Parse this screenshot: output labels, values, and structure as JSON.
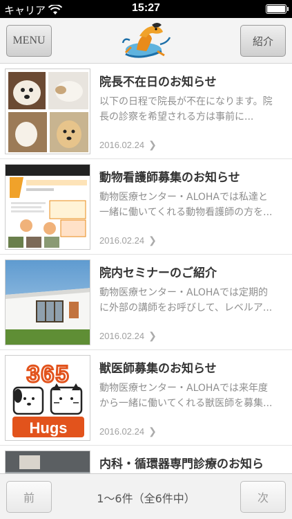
{
  "status_bar": {
    "carrier": "キャリア",
    "time": "15:27"
  },
  "header": {
    "menu_label": "MENU",
    "intro_label": "紹介",
    "logo_icon": "surfing-dog-logo"
  },
  "articles": [
    {
      "title": "院長不在日のお知らせ",
      "excerpt": "以下の日程で院長が不在になります。院長の診察を希望される方は事前に...",
      "date": "2016.02.24"
    },
    {
      "title": "動物看護師募集のお知らせ",
      "excerpt": "動物医療センター・ALOHAでは私達と一緒に働いてくれる動物看護師の方を...",
      "date": "2016.02.24"
    },
    {
      "title": "院内セミナーのご紹介",
      "excerpt": "動物医療センター・ALOHAでは定期的に外部の講師をお呼びして、レベルア...",
      "date": "2016.02.24"
    },
    {
      "title": "獣医師募集のお知らせ",
      "excerpt": "動物医療センター・ALOHAでは来年度から一緒に働いてくれる獣医師を募集...",
      "date": "2016.02.24"
    },
    {
      "title": "内科・循環器専門診療のお知ら",
      "excerpt": "",
      "date": ""
    }
  ],
  "thumb4_text": {
    "top": "365",
    "bottom": "Hugs"
  },
  "footer": {
    "prev_label": "前",
    "next_label": "次",
    "pager_text": "1〜6件（全6件中）"
  }
}
